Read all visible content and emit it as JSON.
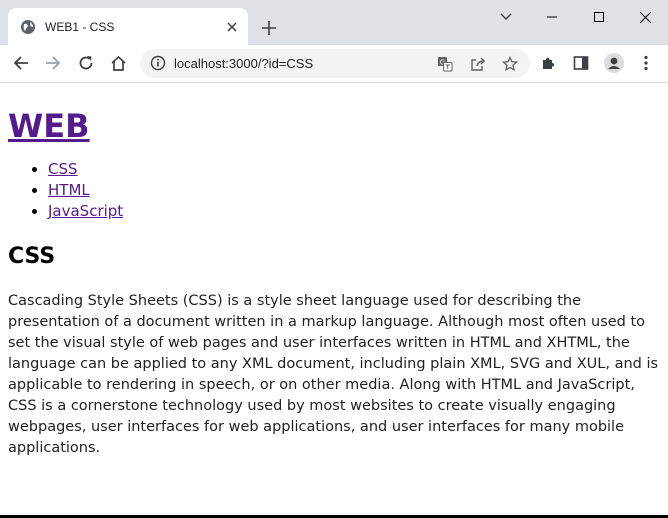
{
  "browser": {
    "tab_title": "WEB1 - CSS",
    "url": "localhost:3000/?id=CSS",
    "icons": {
      "favicon": "globe-icon",
      "tab_close": "close-icon",
      "new_tab": "plus-icon",
      "tab_search": "chevron-down-icon",
      "minimize": "minimize-icon",
      "maximize": "maximize-icon",
      "close_window": "close-icon",
      "back": "back-arrow-icon",
      "forward": "forward-arrow-icon",
      "reload": "reload-icon",
      "home": "home-icon",
      "site_info": "info-icon",
      "translate": "translate-icon",
      "share": "share-icon",
      "bookmark": "star-icon",
      "extensions": "puzzle-icon",
      "side_panel": "side-panel-icon",
      "profile": "avatar-icon",
      "menu": "kebab-menu-icon"
    }
  },
  "page": {
    "site_title": "WEB",
    "nav": [
      {
        "label": "CSS"
      },
      {
        "label": "HTML"
      },
      {
        "label": "JavaScript"
      }
    ],
    "heading": "CSS",
    "body": "Cascading Style Sheets (CSS) is a style sheet language used for describing the presentation of a document written in a markup language. Although most often used to set the visual style of web pages and user interfaces written in HTML and XHTML, the language can be applied to any XML document, including plain XML, SVG and XUL, and is applicable to rendering in speech, or on other media. Along with HTML and JavaScript, CSS is a cornerstone technology used by most websites to create visually engaging webpages, user interfaces for web applications, and user interfaces for many mobile applications.",
    "link_color": "#551a8b"
  }
}
